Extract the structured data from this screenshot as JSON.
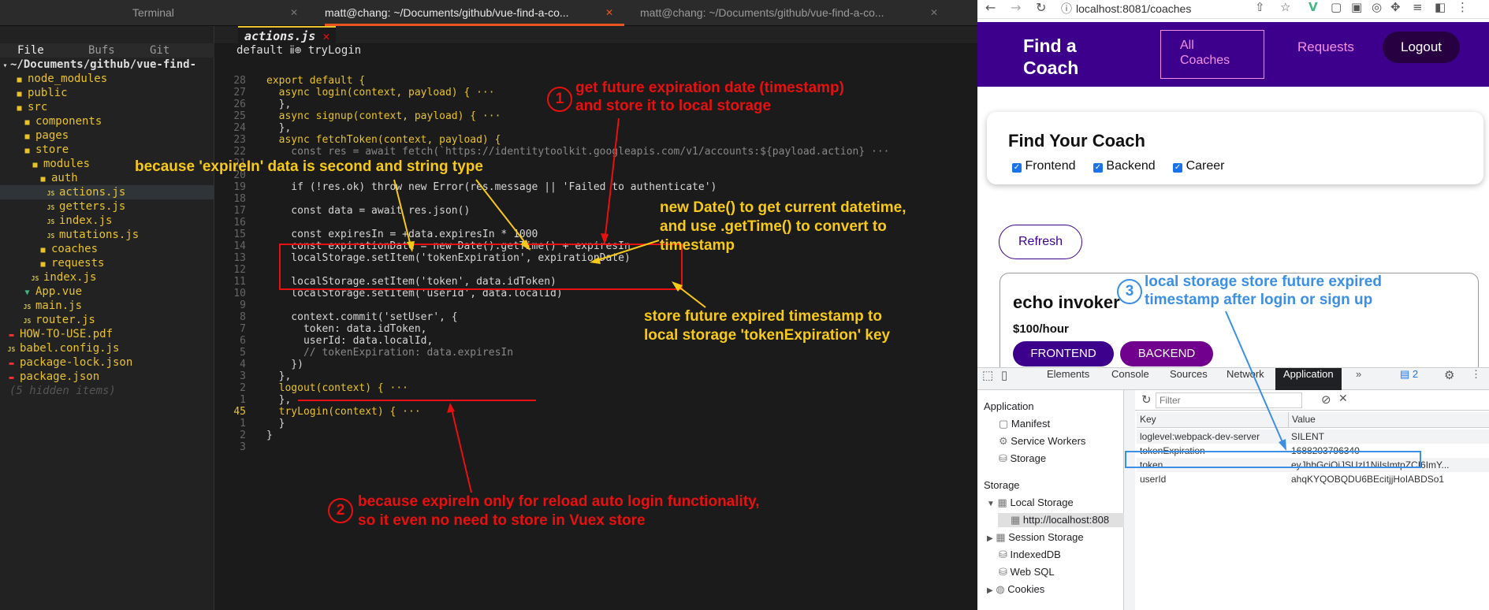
{
  "terminal_tabs": [
    "Terminal",
    "matt@chang: ~/Documents/github/vue-find-a-co...",
    "matt@chang: ~/Documents/github/vue-find-a-co..."
  ],
  "tree": {
    "header": {
      "file": "File",
      "bufs": "Bufs",
      "git": "Git"
    },
    "root": "~/Documents/github/vue-find-",
    "items": [
      {
        "label": "node_modules",
        "type": "folder",
        "indent": 1
      },
      {
        "label": "public",
        "type": "folder",
        "indent": 1
      },
      {
        "label": "src",
        "type": "folder",
        "indent": 1
      },
      {
        "label": "components",
        "type": "folder",
        "indent": 2
      },
      {
        "label": "pages",
        "type": "folder",
        "indent": 2
      },
      {
        "label": "store",
        "type": "folder",
        "indent": 2
      },
      {
        "label": "modules",
        "type": "folder",
        "indent": 3
      },
      {
        "label": "auth",
        "type": "folder",
        "indent": 4
      },
      {
        "label": "actions.js",
        "type": "js",
        "indent": 5
      },
      {
        "label": "getters.js",
        "type": "js",
        "indent": 5
      },
      {
        "label": "index.js",
        "type": "js",
        "indent": 5
      },
      {
        "label": "mutations.js",
        "type": "js",
        "indent": 5
      },
      {
        "label": "coaches",
        "type": "folder",
        "indent": 4
      },
      {
        "label": "requests",
        "type": "folder",
        "indent": 4
      },
      {
        "label": "index.js",
        "type": "js",
        "indent": 3
      },
      {
        "label": "App.vue",
        "type": "vue",
        "indent": 2
      },
      {
        "label": "main.js",
        "type": "js",
        "indent": 2
      },
      {
        "label": "router.js",
        "type": "js",
        "indent": 2
      },
      {
        "label": "HOW-TO-USE.pdf",
        "type": "pdf",
        "indent": 0
      },
      {
        "label": "babel.config.js",
        "type": "js",
        "indent": 0
      },
      {
        "label": "package-lock.json",
        "type": "json",
        "indent": 0
      },
      {
        "label": "package.json",
        "type": "json",
        "indent": 0
      },
      {
        "label": "(5 hidden items)",
        "type": "hidden",
        "indent": 0
      }
    ]
  },
  "editor": {
    "tab": "actions.js",
    "crumb": "default ⅱ⊕ tryLogin",
    "lines": [
      {
        "n": "28",
        "t": "export default {"
      },
      {
        "n": "27",
        "t": "  async login(context, payload) { ···"
      },
      {
        "n": "26",
        "t": "  },"
      },
      {
        "n": "25",
        "t": "  async signup(context, payload) { ···"
      },
      {
        "n": "24",
        "t": "  },"
      },
      {
        "n": "23",
        "t": "  async fetchToken(context, payload) {"
      },
      {
        "n": "22",
        "t": "    const res = await fetch(`https://identitytoolkit.googleapis.com/v1/accounts:${payload.action} ···"
      },
      {
        "n": "21",
        "t": ""
      },
      {
        "n": "20",
        "t": ""
      },
      {
        "n": "19",
        "t": "    if (!res.ok) throw new Error(res.message || 'Failed to authenticate')"
      },
      {
        "n": "18",
        "t": ""
      },
      {
        "n": "17",
        "t": "    const data = await res.json()"
      },
      {
        "n": "16",
        "t": ""
      },
      {
        "n": "15",
        "t": "    const expiresIn = +data.expiresIn * 1000"
      },
      {
        "n": "14",
        "t": "    const expirationDate = new Date().getTime() + expiresIn"
      },
      {
        "n": "13",
        "t": "    localStorage.setItem('tokenExpiration', expirationDate)"
      },
      {
        "n": "12",
        "t": ""
      },
      {
        "n": "11",
        "t": "    localStorage.setItem('token', data.idToken)"
      },
      {
        "n": "10",
        "t": "    localStorage.setItem('userId', data.localId)"
      },
      {
        "n": "9",
        "t": ""
      },
      {
        "n": "8",
        "t": "    context.commit('setUser', {"
      },
      {
        "n": "7",
        "t": "      token: data.idToken,"
      },
      {
        "n": "6",
        "t": "      userId: data.localId,"
      },
      {
        "n": "5",
        "t": "      // tokenExpiration: data.expiresIn"
      },
      {
        "n": "4",
        "t": "    })"
      },
      {
        "n": "3",
        "t": "  },"
      },
      {
        "n": "2",
        "t": "  logout(context) { ···"
      },
      {
        "n": "1",
        "t": "  },"
      },
      {
        "n": "45",
        "t": "  tryLogin(context) { ···"
      },
      {
        "n": "1",
        "t": "  }"
      },
      {
        "n": "2",
        "t": "}"
      },
      {
        "n": "3",
        "t": ""
      }
    ]
  },
  "browser": {
    "url": "localhost:8081/coaches",
    "nav": {
      "title": "Find a Coach",
      "all": "All Coaches",
      "requests": "Requests",
      "logout": "Logout"
    },
    "filter": {
      "title": "Find Your Coach",
      "options": [
        "Frontend",
        "Backend",
        "Career"
      ]
    },
    "refresh": "Refresh",
    "coach": {
      "name": "echo invoker",
      "rate": "$100/hour",
      "badges": [
        "FRONTEND",
        "BACKEND"
      ]
    }
  },
  "devtools": {
    "tabs": [
      "Elements",
      "Console",
      "Sources",
      "Network",
      "Application"
    ],
    "badge": "2",
    "filter_placeholder": "Filter",
    "sidebar": {
      "app_header": "Application",
      "app_items": [
        "Manifest",
        "Service Workers",
        "Storage"
      ],
      "storage_header": "Storage",
      "storage_items": [
        "Local Storage",
        "http://localhost:808",
        "Session Storage",
        "IndexedDB",
        "Web SQL",
        "Cookies"
      ]
    },
    "table": {
      "headers": [
        "Key",
        "Value"
      ],
      "rows": [
        [
          "loglevel:webpack-dev-server",
          "SILENT"
        ],
        [
          "tokenExpiration",
          "1688203796340"
        ],
        [
          "token",
          "eyJhbGciOiJSUzI1NiIsImtpZCI6ImY..."
        ],
        [
          "userId",
          "ahqKYQOBQDU6BEcitjjHoIABDSo1"
        ]
      ]
    }
  },
  "annotations": {
    "a1_num": "1",
    "a1": [
      "get future expiration date (timestamp)",
      "and store it to local storage"
    ],
    "a2_num": "2",
    "a2": [
      "because expireIn only for reload auto login functionality,",
      "so it even no need to store in Vuex store"
    ],
    "a3_num": "3",
    "a3": [
      "local storage store future expired",
      "timestamp after login or sign up"
    ],
    "y1": "because 'expireIn' data is second and string type",
    "y2": [
      "new Date() to get current datetime,",
      "and use .getTime() to convert to",
      "timestamp"
    ],
    "y3": [
      "store future expired timestamp to",
      "local storage 'tokenExpiration' key"
    ]
  },
  "colors": {
    "accent": "#3d008d",
    "pink": "#f391e3",
    "annotation_red": "#e81010",
    "annotation_yellow": "#f7c919",
    "annotation_blue": "#3b8fe4"
  }
}
